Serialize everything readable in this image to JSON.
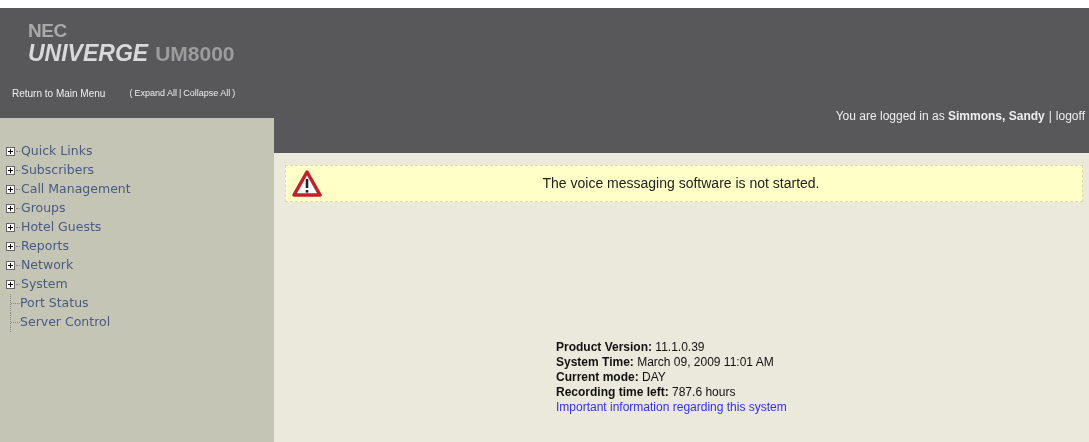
{
  "header": {
    "logo": {
      "brand": "NEC",
      "product": "UNIVERGE",
      "model": "UM8000"
    },
    "nav": {
      "main_menu": "Return to Main Menu",
      "open_paren": "(",
      "expand_all": "Expand All",
      "separator": "|",
      "collapse_all": "Collapse All",
      "close_paren": ")"
    },
    "login": {
      "prefix": "You are logged in as",
      "user": "Simmons, Sandy",
      "separator": "|",
      "logoff": "logoff"
    }
  },
  "sidebar": {
    "items": [
      {
        "label": "Quick Links",
        "kind": "folder",
        "expanded": false
      },
      {
        "label": "Subscribers",
        "kind": "folder",
        "expanded": false
      },
      {
        "label": "Call Management",
        "kind": "folder",
        "expanded": false
      },
      {
        "label": "Groups",
        "kind": "folder",
        "expanded": false
      },
      {
        "label": "Hotel Guests",
        "kind": "folder",
        "expanded": false
      },
      {
        "label": "Reports",
        "kind": "folder",
        "expanded": false
      },
      {
        "label": "Network",
        "kind": "folder",
        "expanded": false
      },
      {
        "label": "System",
        "kind": "folder",
        "expanded": false
      },
      {
        "label": "Port Status",
        "kind": "leaf"
      },
      {
        "label": "Server Control",
        "kind": "leaf"
      }
    ]
  },
  "alert": {
    "message": "The voice messaging software is not started."
  },
  "info": {
    "lines": [
      {
        "label": "Product Version:",
        "value": "11.1.0.39"
      },
      {
        "label": "System Time:",
        "value": "March 09, 2009 11:01 AM"
      },
      {
        "label": "Current mode:",
        "value": "DAY"
      },
      {
        "label": "Recording time left:",
        "value": "787.6 hours"
      }
    ],
    "link": "Important information regarding this system"
  }
}
